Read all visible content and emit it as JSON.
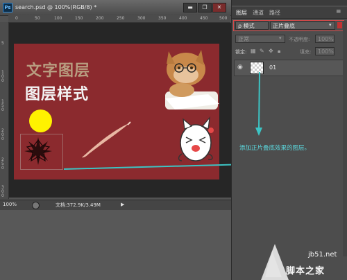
{
  "document": {
    "tab_title": "search.psd @ 100%(RGB/8) *",
    "ps_logo": "Ps",
    "win_buttons": [
      "▬",
      "❐",
      "✕"
    ],
    "ruler_top_labels": [
      "0",
      "50",
      "100",
      "150",
      "200",
      "250",
      "300",
      "350",
      "400",
      "450",
      "500"
    ],
    "ruler_left_labels": [
      "5",
      "1 0 0",
      "1 5 0",
      "2 0 0",
      "2 5 0",
      "3 0 0"
    ],
    "artwork": {
      "title_line1": "文字图层",
      "title_line2": "图层样式"
    },
    "status": {
      "zoom": "100%",
      "doc_info": "文档:372.9K/3.49M"
    }
  },
  "layers_panel": {
    "tabs": [
      "图层",
      "通道",
      "路径"
    ],
    "filter_kind": "ρ 模式",
    "blend_search": "正片叠底",
    "mode": "正常",
    "opacity_label": "不透明度:",
    "opacity_value": "100%",
    "lock_label": "锁定:",
    "fill_label": "填充:",
    "fill_value": "100%",
    "layer_name": "01"
  },
  "annotation": "添加正片叠底效果的图层。",
  "watermark": {
    "line1": "jb51.net",
    "line2": "脚本之家"
  },
  "colors": {
    "artboard": "#8b2a2e",
    "annotation": "#5bd7dd",
    "highlight_box": "#d84a4a",
    "arrow": "#3cc4c4"
  },
  "icons": [
    "eye-icon",
    "menu-icon",
    "chevron-down-icon",
    "lock-icon",
    "watermark-logo"
  ]
}
